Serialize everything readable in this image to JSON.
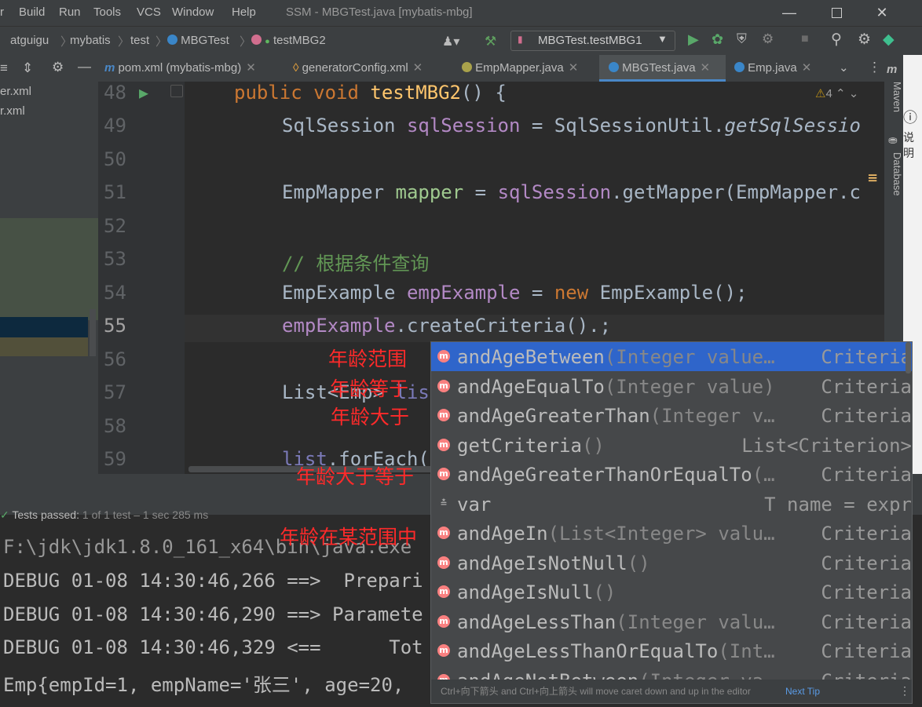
{
  "menu": {
    "items": [
      "r",
      "Build",
      "Run",
      "Tools",
      "VCS",
      "Window",
      "Help"
    ],
    "title": "SSM - MBGTest.java [mybatis-mbg]"
  },
  "navbar": {
    "crumbs": [
      "atguigu",
      "mybatis",
      "test",
      "MBGTest",
      "testMBG2"
    ],
    "run_config": "MBGTest.testMBG1"
  },
  "tabs": [
    {
      "label": "pom.xml (mybatis-mbg)"
    },
    {
      "label": "generatorConfig.xml"
    },
    {
      "label": "EmpMapper.java"
    },
    {
      "label": "MBGTest.java"
    },
    {
      "label": "Emp.java"
    }
  ],
  "leftpanel": {
    "files": [
      "er.xml",
      "r.xml"
    ]
  },
  "editor": {
    "line_numbers": [
      "48",
      "49",
      "50",
      "51",
      "52",
      "53",
      "54",
      "55",
      "56",
      "57",
      "58",
      "59"
    ],
    "warnings": "4",
    "lines": {
      "l48_kw": "public void ",
      "l48_fn": "testMBG2",
      "l48_rest": "() {",
      "l49_type": "SqlSession ",
      "l49_var": "sqlSession",
      "l49_mid": " = SqlSessionUtil.",
      "l49_call": "getSqlSessio",
      "l51_type": "EmpMapper ",
      "l51_var": "mapper",
      "l51_mid": " = ",
      "l51_obj": "sqlSession",
      "l51_rest": ".getMapper(EmpMapper.c",
      "l53_cmt": "// 根据条件查询",
      "l54_type": "EmpExample ",
      "l54_var": "empExample",
      "l54_mid": " = ",
      "l54_kw": "new",
      "l54_rest": " EmpExample();",
      "l55_var": "empExample",
      "l55_rest": ".createCriteria().;",
      "l57_type": "List<Emp> ",
      "l57_var": "lis",
      "l59_var": "list",
      "l59_rest": ".forEach("
    }
  },
  "rightstrip": {
    "maven": "Maven",
    "database": "Database"
  },
  "tests": {
    "status": "Tests passed:",
    "count": "1",
    "detail": "of 1 test – 1 sec 285 ms"
  },
  "console": [
    "F:\\jdk\\jdk1.8.0_161_x64\\bin\\java.exe",
    "DEBUG 01-08 14:30:46,266 ==>  Prepari",
    "DEBUG 01-08 14:30:46,290 ==> Paramete",
    "DEBUG 01-08 14:30:46,329 <==      Tot",
    "Emp{empId=1, empName='张三', age=20,"
  ],
  "annotations": [
    "年龄范围",
    "年龄等于",
    "年龄大于",
    "年龄大于等于",
    "年龄在某范围中"
  ],
  "completion": {
    "items": [
      {
        "name": "andAgeBetween",
        "sig": "(Integer value…",
        "type": "Criteria",
        "selected": true
      },
      {
        "name": "andAgeEqualTo",
        "sig": "(Integer value)",
        "type": "Criteria"
      },
      {
        "name": "andAgeGreaterThan",
        "sig": "(Integer v…",
        "type": "Criteria"
      },
      {
        "name": "getCriteria",
        "sig": "()",
        "type": "List<Criterion>"
      },
      {
        "name": "andAgeGreaterThanOrEqualTo",
        "sig": "(…",
        "type": "Criteria"
      },
      {
        "name": "var",
        "sig": "",
        "type": "T name = expr",
        "template": true
      },
      {
        "name": "andAgeIn",
        "sig": "(List<Integer> valu…",
        "type": "Criteria"
      },
      {
        "name": "andAgeIsNotNull",
        "sig": "()",
        "type": "Criteria"
      },
      {
        "name": "andAgeIsNull",
        "sig": "()",
        "type": "Criteria"
      },
      {
        "name": "andAgeLessThan",
        "sig": "(Integer valu…",
        "type": "Criteria"
      },
      {
        "name": "andAgeLessThanOrEqualTo",
        "sig": "(Int…",
        "type": "Criteria"
      },
      {
        "name": "andAgeNotBetween",
        "sig": "(Integer va…",
        "type": "Criteria"
      }
    ],
    "footer_hint": "Ctrl+向下箭头 and Ctrl+向上箭头 will move caret down and up in the editor",
    "next_tip": "Next Tip"
  },
  "colors": {
    "accent": "#4a88c7",
    "selection": "#2f65ca",
    "annotation": "#ff2a2a"
  }
}
